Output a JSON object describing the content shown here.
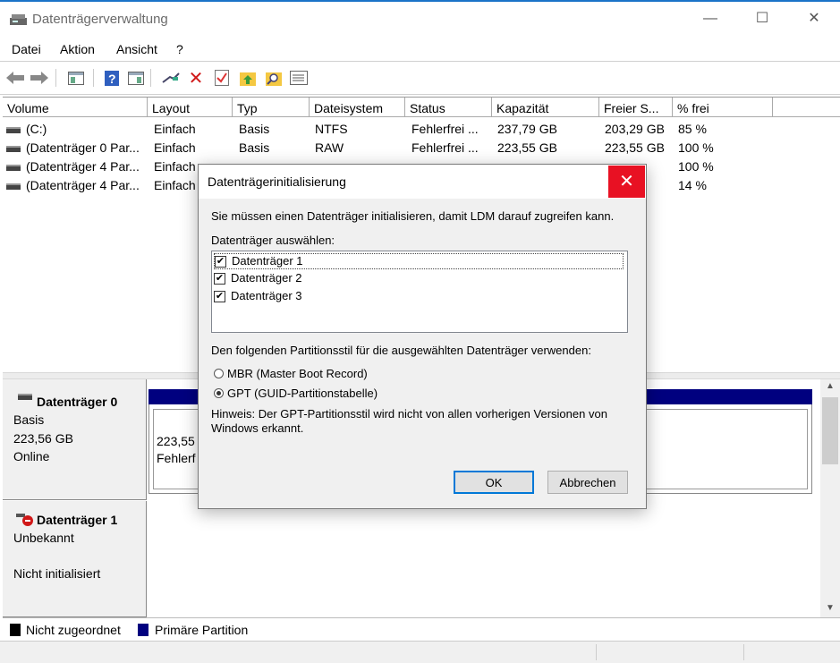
{
  "window": {
    "title": "Datenträgerverwaltung",
    "minimize": "—",
    "maximize": "☐",
    "close": "✕"
  },
  "menu": [
    "Datei",
    "Aktion",
    "Ansicht",
    "?"
  ],
  "toolbar": [
    "back-arrow-icon",
    "forward-arrow-icon",
    "console-tree-icon",
    "help-icon",
    "action-pane-icon",
    "connect-icon",
    "delete-icon",
    "properties-icon",
    "refresh-folder-icon",
    "search-folder-icon",
    "list-view-icon"
  ],
  "volumes": {
    "headers": [
      "Volume",
      "Layout",
      "Typ",
      "Dateisystem",
      "Status",
      "Kapazität",
      "Freier S...",
      "% frei"
    ],
    "rows": [
      [
        "(C:)",
        "Einfach",
        "Basis",
        "NTFS",
        "Fehlerfrei ...",
        "237,79 GB",
        "203,29 GB",
        "85 %"
      ],
      [
        "(Datenträger 0 Par...",
        "Einfach",
        "Basis",
        "RAW",
        "Fehlerfrei ...",
        "223,55 GB",
        "223,55 GB",
        "100 %"
      ],
      [
        "(Datenträger 4 Par...",
        "Einfach",
        "",
        "",
        "",
        "",
        "",
        "100 %"
      ],
      [
        "(Datenträger 4 Par...",
        "Einfach",
        "",
        "",
        "",
        "",
        "",
        "14 %"
      ]
    ]
  },
  "disks": [
    {
      "name": "Datenträger 0",
      "type": "Basis",
      "size": "223,56 GB",
      "state": "Online",
      "partition_size": "223,55",
      "partition_status": "Fehlerf"
    },
    {
      "name": "Datenträger 1",
      "type": "Unbekannt",
      "state": "Nicht initialisiert"
    }
  ],
  "legend": {
    "unallocated": "Nicht zugeordnet",
    "primary": "Primäre Partition"
  },
  "colors": {
    "primary_partition": "#00007f",
    "unallocated": "#000000",
    "close_red": "#e81123"
  },
  "dialog": {
    "title": "Datenträgerinitialisierung",
    "intro": "Sie müssen einen Datenträger initialisieren, damit LDM darauf zugreifen kann.",
    "select_label": "Datenträger auswählen:",
    "disks": [
      "Datenträger 1",
      "Datenträger 2",
      "Datenträger 3"
    ],
    "style_label": "Den folgenden Partitionsstil für die ausgewählten Datenträger verwenden:",
    "mbr": "MBR (Master Boot Record)",
    "gpt": "GPT (GUID-Partitionstabelle)",
    "hint": "Hinweis: Der GPT-Partitionsstil wird nicht von allen vorherigen Versionen von Windows erkannt.",
    "ok": "OK",
    "cancel": "Abbrechen"
  }
}
